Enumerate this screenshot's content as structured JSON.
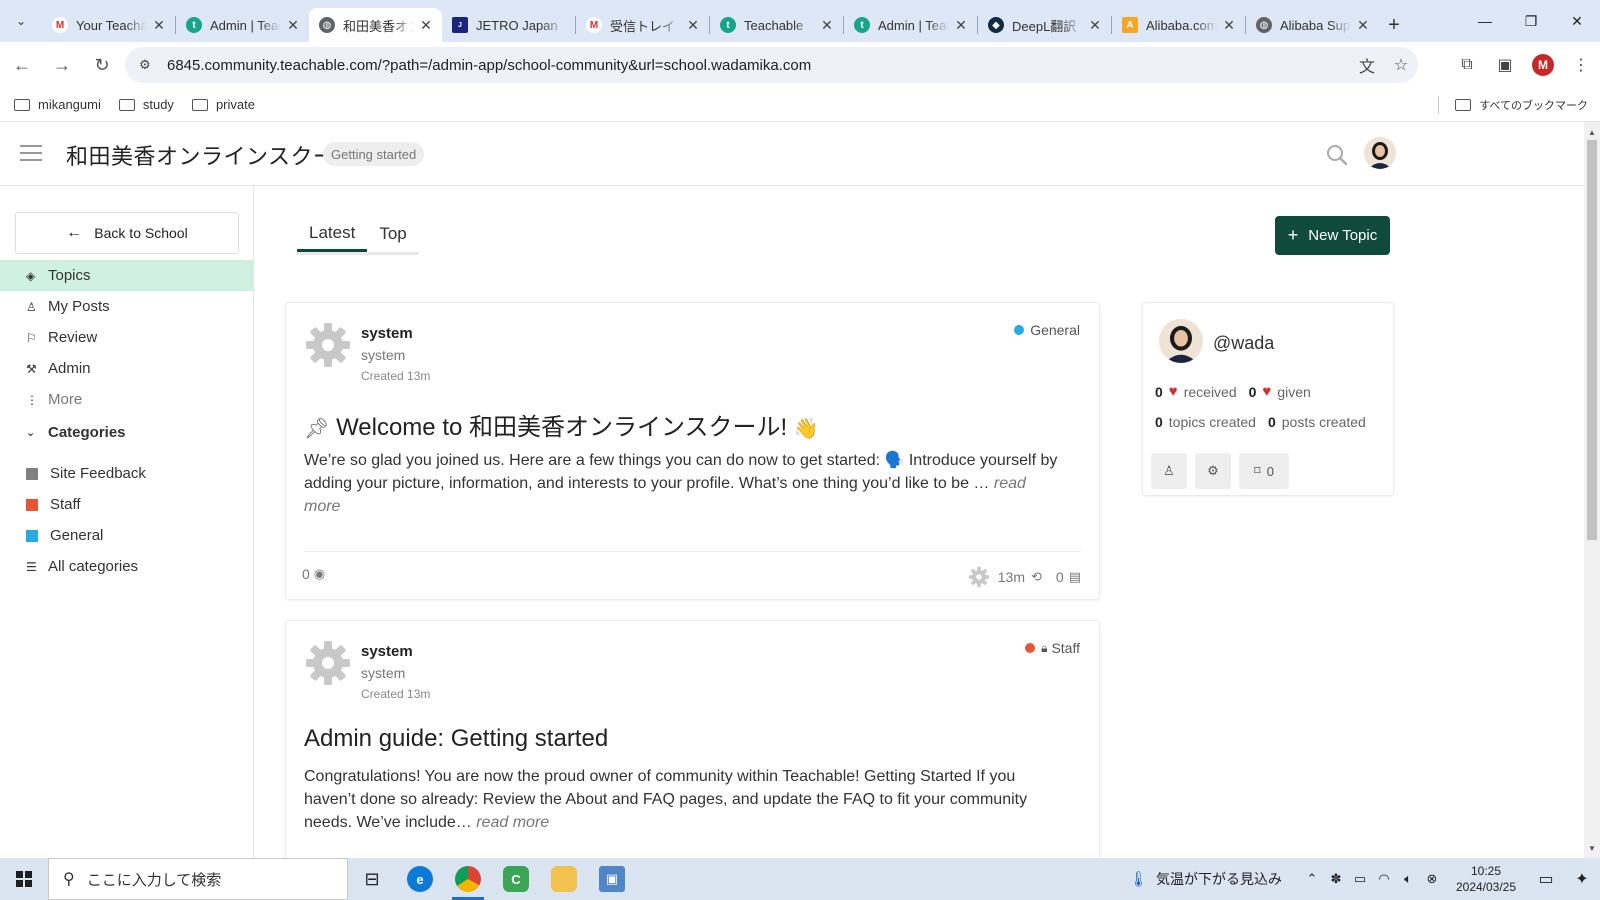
{
  "browser": {
    "tabs": [
      {
        "title": "Your Teachable",
        "favicon": "gmail-icon",
        "active": false
      },
      {
        "title": "Admin | Teachable",
        "favicon": "teachable-icon",
        "active": false
      },
      {
        "title": "和田美香オンライン",
        "favicon": "globe-icon",
        "active": true
      },
      {
        "title": "JETRO Japan",
        "favicon": "jetro-icon",
        "active": false
      },
      {
        "title": "受信トレイ（",
        "favicon": "gmail-icon",
        "active": false
      },
      {
        "title": "Teachable",
        "favicon": "teachable-icon",
        "active": false
      },
      {
        "title": "Admin | Teachable",
        "favicon": "teachable-icon",
        "active": false
      },
      {
        "title": "DeepL翻訳",
        "favicon": "deepl-icon",
        "active": false
      },
      {
        "title": "Alibaba.com",
        "favicon": "alibaba-icon",
        "active": false
      },
      {
        "title": "Alibaba Sup",
        "favicon": "globe-icon",
        "active": false
      }
    ],
    "url": "6845.community.teachable.com/?path=/admin-app/school-community&url=school.wadamika.com",
    "profile_initial": "M",
    "bookmarks": [
      "mikangumi",
      "study",
      "private"
    ],
    "all_bookmarks": "すべてのブックマーク"
  },
  "header": {
    "site_title": "和田美香オンラインスクール",
    "badge": "Getting started"
  },
  "sidebar": {
    "back_label": "Back to School",
    "nav": [
      {
        "label": "Topics",
        "icon": "layers-icon",
        "active": true
      },
      {
        "label": "My Posts",
        "icon": "user-icon",
        "active": false
      },
      {
        "label": "Review",
        "icon": "flag-icon",
        "active": false
      },
      {
        "label": "Admin",
        "icon": "wrench-icon",
        "active": false
      },
      {
        "label": "More",
        "icon": "more-vertical-icon",
        "active": false
      }
    ],
    "categories_heading": "Categories",
    "categories": [
      {
        "label": "Site Feedback",
        "color": "#808080"
      },
      {
        "label": "Staff",
        "color": "#e45735"
      },
      {
        "label": "General",
        "color": "#25aae1"
      },
      {
        "label": "All categories",
        "color": ""
      }
    ]
  },
  "main": {
    "tabs": [
      "Latest",
      "Top"
    ],
    "new_topic_label": "New Topic",
    "posts": [
      {
        "author": "system",
        "username": "system",
        "created": "Created 13m",
        "category": "General",
        "category_color": "#25aae1",
        "pinned": true,
        "title": "Welcome to 和田美香オンラインスクール!",
        "excerpt": "We’re so glad you joined us. Here are a few things you can do now to get started: 🗣️ Introduce yourself by adding your picture, information, and interests to your profile. What’s one thing you’d like to be …",
        "read_more": "read more",
        "views": "0",
        "activity": "13m",
        "replies": "0"
      },
      {
        "author": "system",
        "username": "system",
        "created": "Created 13m",
        "category": "Staff",
        "category_color": "#e45735",
        "pinned": false,
        "title": "Admin guide: Getting started",
        "excerpt": "Congratulations! You are now the proud owner of community within Teachable! Getting Started If you haven’t done so already: Review the About and FAQ pages, and update the FAQ to fit your community needs. We’ve include…",
        "read_more": "read more"
      }
    ]
  },
  "profile_card": {
    "username": "@wada",
    "received_count": "0",
    "received_label": "received",
    "given_count": "0",
    "given_label": "given",
    "topics_count": "0",
    "topics_label": "topics created",
    "posts_count": "0",
    "posts_label": "posts created",
    "bookmarks_count": "0"
  },
  "taskbar": {
    "search_placeholder": "ここに入力して検索",
    "weather": "気温が下がる見込み",
    "time": "10:25",
    "date": "2024/03/25"
  },
  "colors": {
    "accent": "#0f4a3c",
    "active_nav_bg": "#d1f0e4",
    "heart": "#d32f2f"
  }
}
